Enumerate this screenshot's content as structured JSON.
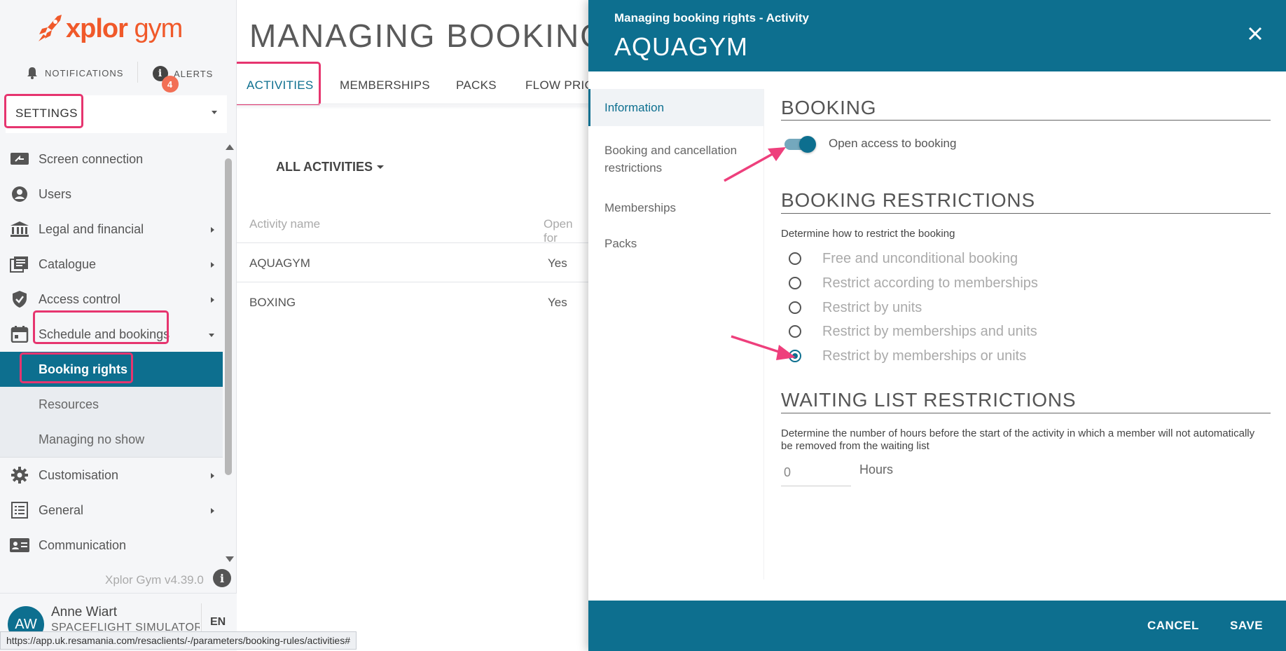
{
  "brand": {
    "logo_text_bold": "xplor",
    "logo_text_light": "gym",
    "accent": "#0d6f8f",
    "logo_color": "#f0592a"
  },
  "topbar": {
    "notifications_label": "NOTIFICATIONS",
    "alerts_label": "ALERTS",
    "alerts_badge": "4"
  },
  "sidebar": {
    "section_select": "SETTINGS",
    "items": [
      {
        "label": "Screen connection",
        "icon": "screen-icon",
        "has_chevron": false
      },
      {
        "label": "Users",
        "icon": "user-circle-icon",
        "has_chevron": false
      },
      {
        "label": "Legal and financial",
        "icon": "bank-icon",
        "has_chevron": true
      },
      {
        "label": "Catalogue",
        "icon": "catalogue-icon",
        "has_chevron": true
      },
      {
        "label": "Access control",
        "icon": "shield-icon",
        "has_chevron": true
      },
      {
        "label": "Schedule and bookings",
        "icon": "calendar-icon",
        "has_chevron": true,
        "expanded": true
      },
      {
        "label": "Booking rights",
        "sub": true,
        "active": true
      },
      {
        "label": "Resources",
        "sub": true
      },
      {
        "label": "Managing no show",
        "sub": true
      },
      {
        "label": "Customisation",
        "icon": "gear-icon",
        "has_chevron": true
      },
      {
        "label": "General",
        "icon": "list-icon",
        "has_chevron": true
      },
      {
        "label": "Communication",
        "icon": "contact-card-icon",
        "has_chevron": false
      }
    ],
    "version": "Xplor Gym v4.39.0",
    "user": {
      "initials": "AW",
      "name": "Anne Wiart",
      "org": "SPACEFLIGHT SIMULATOR",
      "lang": "EN"
    }
  },
  "status_bar": {
    "url": "https://app.uk.resamania.com/resaclients/-/parameters/booking-rules/activities#"
  },
  "main": {
    "title": "MANAGING BOOKING RI",
    "tabs": [
      {
        "label": "ACTIVITIES",
        "active": true
      },
      {
        "label": "MEMBERSHIPS"
      },
      {
        "label": "PACKS"
      },
      {
        "label": "FLOW PRIO"
      }
    ],
    "filter_label": "ALL ACTIVITIES",
    "table": {
      "headers": [
        "Activity name",
        "Open for"
      ],
      "rows": [
        {
          "name": "AQUAGYM",
          "open": "Yes"
        },
        {
          "name": "BOXING",
          "open": "Yes"
        }
      ]
    }
  },
  "panel": {
    "subtitle": "Managing booking rights - Activity",
    "title": "AQUAGYM",
    "nav": [
      {
        "label": "Information",
        "active": true
      },
      {
        "label": "Booking and cancellation restrictions"
      },
      {
        "label": "Memberships"
      },
      {
        "label": "Packs"
      }
    ],
    "booking": {
      "section_title": "BOOKING",
      "toggle_label": "Open access to booking",
      "toggle_on": true
    },
    "restrictions": {
      "section_title": "BOOKING RESTRICTIONS",
      "help": "Determine how to restrict the booking",
      "options": [
        "Free and unconditional booking",
        "Restrict according to memberships",
        "Restrict by units",
        "Restrict by memberships and units",
        "Restrict by memberships or units"
      ],
      "selected_index": 4
    },
    "waiting": {
      "section_title": "WAITING LIST RESTRICTIONS",
      "help": "Determine the number of hours before the start of the activity in which a member will not automatically be removed from the waiting list",
      "hours_value": "0",
      "hours_label": "Hours"
    },
    "footer": {
      "cancel_label": "CANCEL",
      "save_label": "SAVE"
    }
  }
}
